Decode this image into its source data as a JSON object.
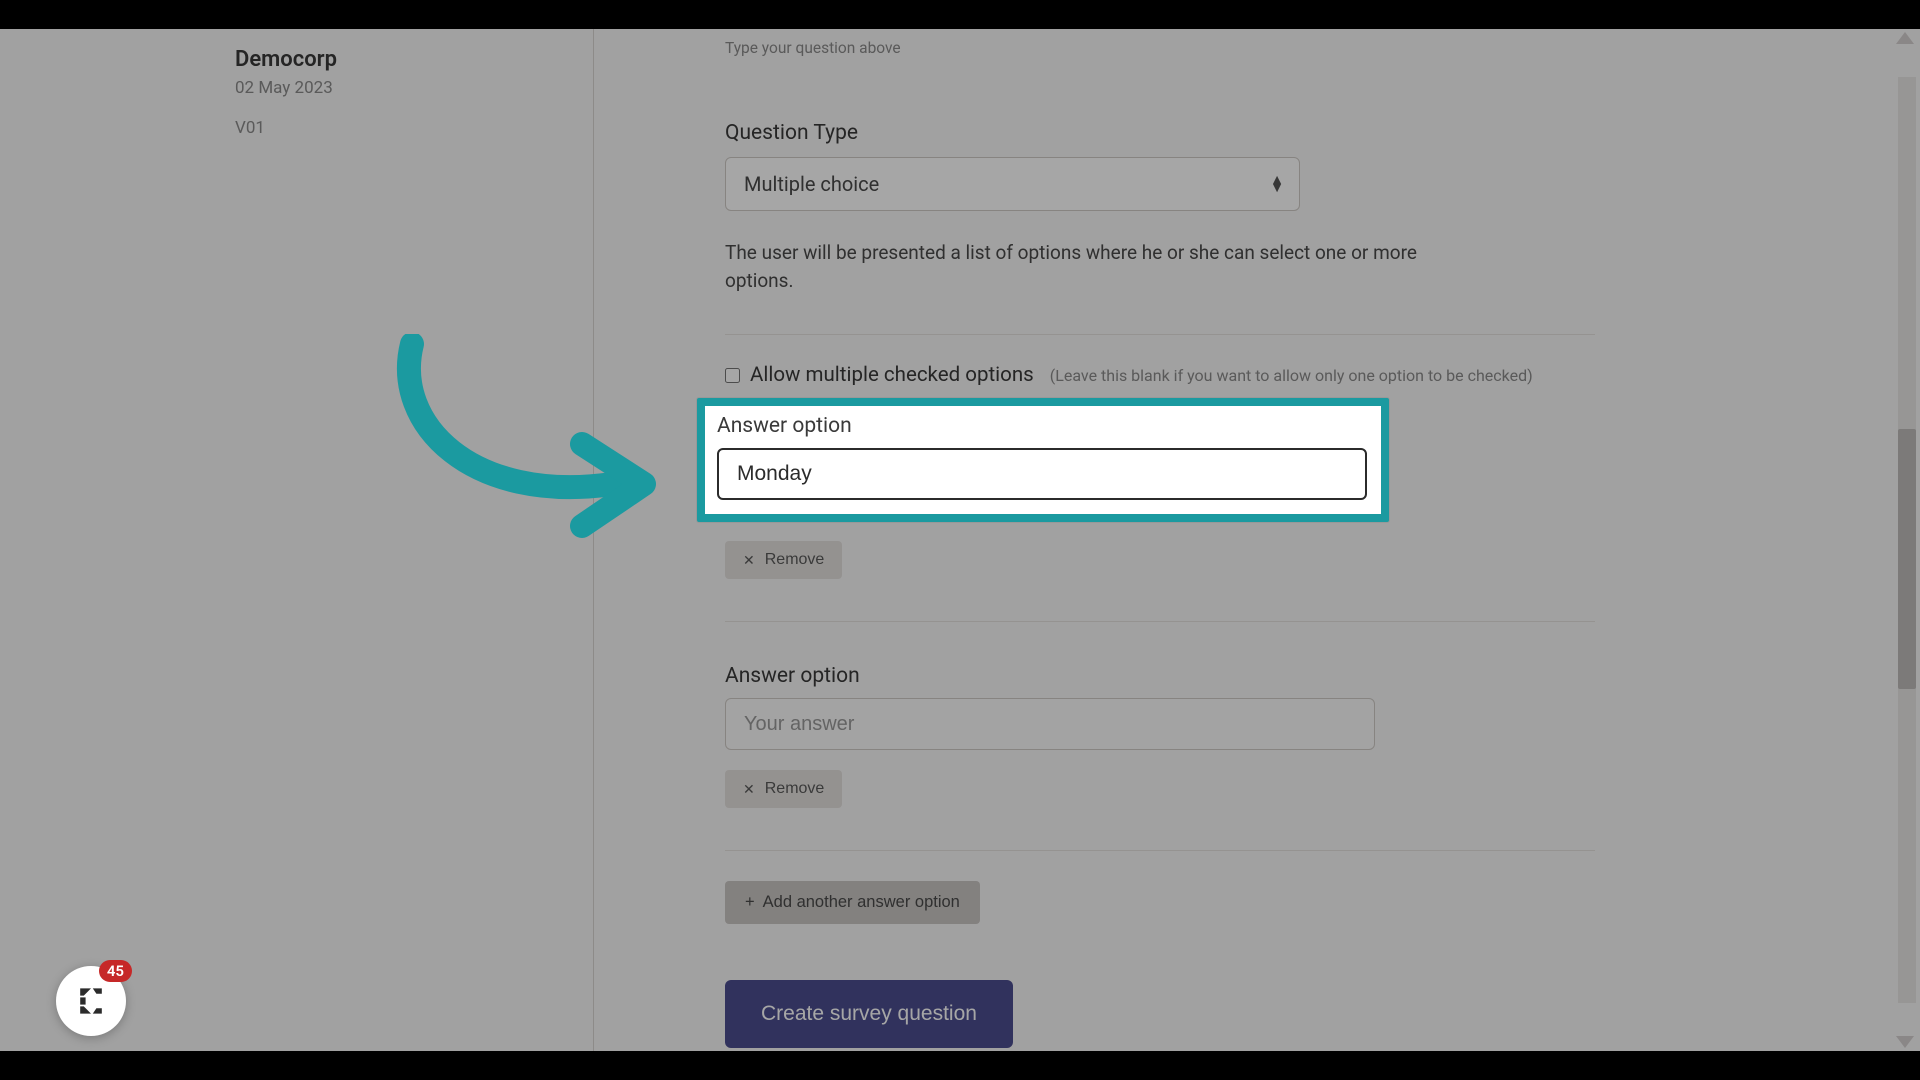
{
  "sidebar": {
    "org_name": "Democorp",
    "date": "02 May 2023",
    "version": "V01"
  },
  "main": {
    "question_hint": "Type your question above",
    "qtype_label": "Question Type",
    "qtype_value": "Multiple choice",
    "qtype_desc": "The user will be presented a list of options where he or she can select one or more options.",
    "allow_multiple_label": "Allow multiple checked options",
    "allow_multiple_hint": "(Leave this blank if you want to allow only one option to be checked)",
    "answer_options": [
      {
        "label": "Answer option",
        "value": "Monday",
        "placeholder": "Your answer",
        "remove_label": "Remove"
      },
      {
        "label": "Answer option",
        "value": "",
        "placeholder": "Your answer",
        "remove_label": "Remove"
      }
    ],
    "add_option_label": "Add another answer option",
    "create_label": "Create survey question"
  },
  "widget": {
    "badge_count": "45"
  },
  "annotation": {
    "arrow_color": "#1b9aa0",
    "highlight_color": "#1b9aa0"
  }
}
